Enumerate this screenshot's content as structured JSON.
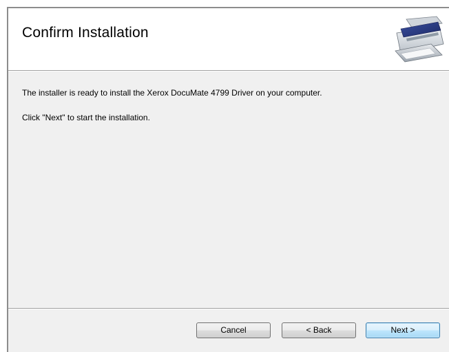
{
  "dialog": {
    "title": "Confirm Installation",
    "icon": "scanner-icon",
    "message_line1": "The installer is ready to install the Xerox DocuMate 4799 Driver on your computer.",
    "message_line2": "Click \"Next\" to start the installation."
  },
  "buttons": {
    "cancel_label": "Cancel",
    "back_label": "< Back",
    "next_label": "Next >"
  },
  "colors": {
    "header_bg": "#ffffff",
    "body_bg": "#f0f0f0",
    "default_button_border": "#3c7fb1"
  }
}
